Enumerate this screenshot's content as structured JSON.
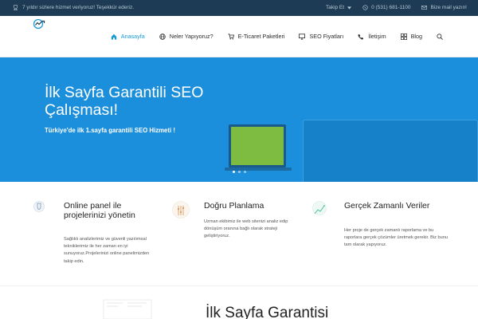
{
  "topbar": {
    "message": "7 yıldır sizlere hizmet veriyoruz! Teşekkür ederiz.",
    "follow_label": "Takip Et",
    "phone": "0 (531) 681-1100",
    "mail_label": "Bize mail yazın!",
    "colors": {
      "background": "#1d3b54",
      "text": "#b7c6d3"
    }
  },
  "nav": {
    "items": [
      {
        "label": "Anasayfa",
        "icon": "home-icon"
      },
      {
        "label": "Neler Yapıyoruz?",
        "icon": "globe-icon"
      },
      {
        "label": "E-Ticaret Paketleri",
        "icon": "cart-icon"
      },
      {
        "label": "SEO Fiyatları",
        "icon": "monitor-icon"
      },
      {
        "label": "İletişim",
        "icon": "phone-icon"
      },
      {
        "label": "Blog",
        "icon": "grid-icon"
      }
    ],
    "active_index": 0,
    "search_icon": "search-icon",
    "colors": {
      "active": "#1b9ad6",
      "text": "#2c2c2c"
    }
  },
  "hero": {
    "title": "İlk Sayfa Garantili SEO Çalışması!",
    "subtitle": "Türkiye'de ilk 1.sayfa garantili SEO Hizmeti !",
    "slides": 3,
    "active_slide": 0,
    "colors": {
      "background": "#1c8fdc",
      "laptop_screen": "#7dbb41"
    }
  },
  "features": [
    {
      "title": "Online panel ile projelerinizi yönetin",
      "text": "Sağlıklı analizlerimiz ve güvenli yazılımsal tekniklerimiz ile her zaman en iyi sunuyoruz.Projelerinizi online panelimizden takip edin.",
      "icon": "shield-icon"
    },
    {
      "title": "Doğru Planlama",
      "text": "Uzman ekibimiz ile web sitenizi analiz edip dönüşüm oranına bağlı olarak strateji geliştiriyoruz.",
      "icon": "sliders-icon"
    },
    {
      "title": "Gerçek Zamanlı Veriler",
      "text": "Her proje de gerçek zamanlı raporlama ve bu raporlara gerçek çözümler üretmek gerekir. Biz bunu tam olarak yapıyoruz.",
      "icon": "line-chart-icon"
    }
  ],
  "section": {
    "title": "İlk Sayfa Garantisi"
  }
}
